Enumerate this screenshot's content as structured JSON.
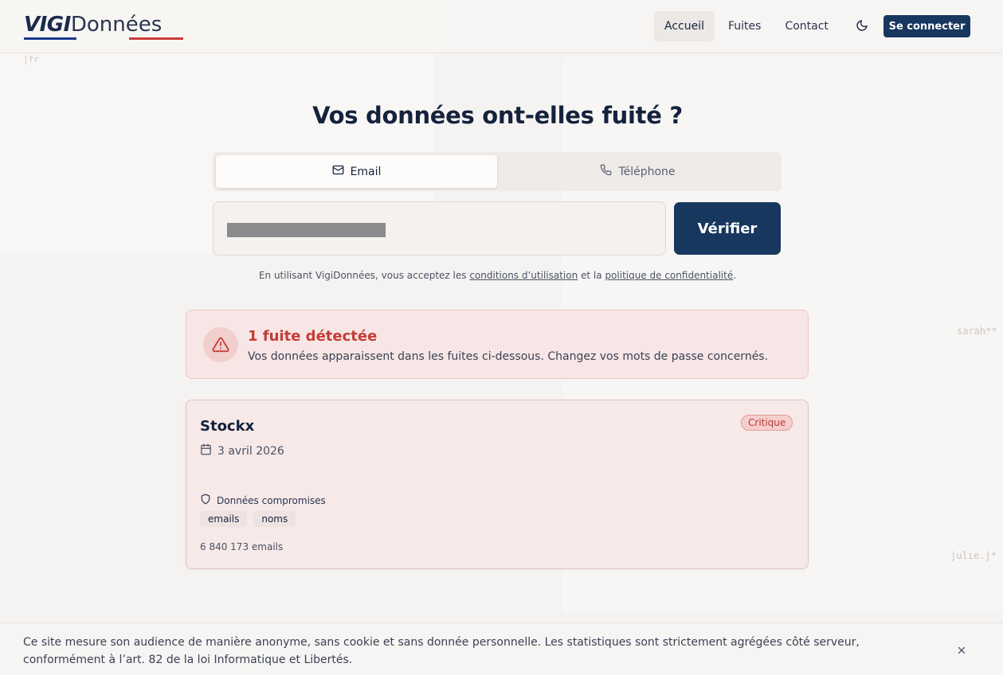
{
  "header": {
    "logo_primary": "VIGI",
    "logo_secondary": "Données",
    "nav": [
      "Accueil",
      "Fuites",
      "Contact"
    ],
    "active_nav": "Accueil",
    "theme_icon": "moon-icon",
    "login_label": "Se connecter"
  },
  "language": "|fr",
  "background_snippets": [
    "sarah**",
    "julie.j*"
  ],
  "hero": {
    "title": "Vos données ont-elles fuité ?",
    "tabs": [
      {
        "label": "Email",
        "icon": "mail-icon",
        "active": true
      },
      {
        "label": "Téléphone",
        "icon": "phone-icon",
        "active": false
      }
    ],
    "search_value": "",
    "verify_label": "Vérifier",
    "terms_prefix": "En utilisant VigiDonnées, vous acceptez les ",
    "terms_link": "conditions d’utilisation",
    "terms_middle": " et la ",
    "privacy_link": "politique de confidentialité",
    "terms_suffix": "."
  },
  "alert": {
    "title": "1 fuite détectée",
    "text": "Vos données apparaissent dans les fuites ci-dessous. Changez vos mots de passe concernés.",
    "icon": "warning-icon"
  },
  "breach": {
    "name": "Stockx",
    "severity": "Critique",
    "date": "3 avril 2026",
    "section_label": "Données compromises",
    "tags": [
      "emails",
      "noms"
    ],
    "count": "6 840 173 emails"
  },
  "cookie_banner": {
    "text": "Ce site mesure son audience de manière anonyme, sans cookie et sans donnée personnelle. Les statistiques sont strictement agrégées côté serveur, conformément à l’art. 82 de la loi Informatique et Libertés."
  },
  "colors": {
    "brand_navy": "#17375e",
    "alert_red": "#c63b35",
    "logo_blue": "#1c3a8c",
    "logo_red": "#c93a3a"
  }
}
